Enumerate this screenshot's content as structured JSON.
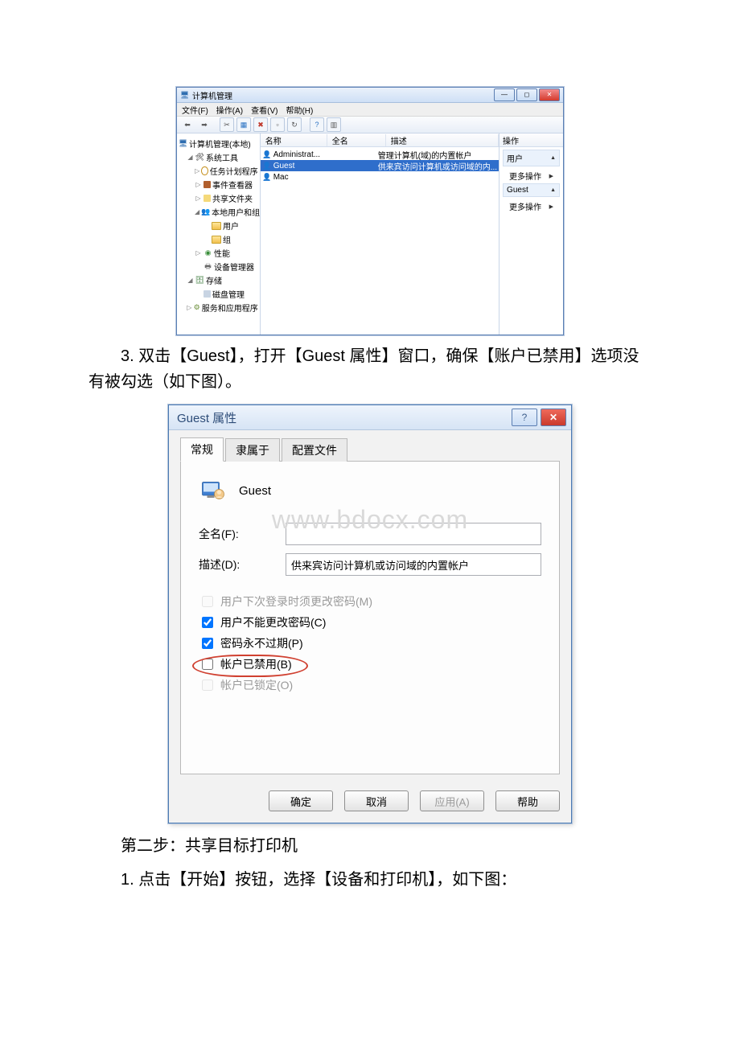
{
  "mmc": {
    "title": "计算机管理",
    "menus": [
      "文件(F)",
      "操作(A)",
      "查看(V)",
      "帮助(H)"
    ],
    "tree": {
      "root": "计算机管理(本地)",
      "systools": "系统工具",
      "task": "任务计划程序",
      "event": "事件查看器",
      "shared": "共享文件夹",
      "localusers": "本地用户和组",
      "users": "用户",
      "groups": "组",
      "perf": "性能",
      "devmgr": "设备管理器",
      "storage": "存储",
      "diskmgmt": "磁盘管理",
      "svcapps": "服务和应用程序"
    },
    "list": {
      "headers": {
        "name": "名称",
        "fullname": "全名",
        "desc": "描述"
      },
      "rows": [
        {
          "name": "Administrat...",
          "full": "",
          "desc": "管理计算机(域)的内置帐户"
        },
        {
          "name": "Guest",
          "full": "",
          "desc": "供来宾访问计算机或访问域的内..."
        },
        {
          "name": "Mac",
          "full": "",
          "desc": ""
        }
      ]
    },
    "actions": {
      "header": "操作",
      "sections": [
        {
          "title": "用户",
          "item": "更多操作"
        },
        {
          "title": "Guest",
          "item": "更多操作"
        }
      ]
    }
  },
  "para1": "3. 双击【Guest】，打开【Guest 属性】窗口，确保【账户已禁用】选项没有被勾选（如下图）。",
  "dlg": {
    "title": "Guest 属性",
    "tabs": [
      "常规",
      "隶属于",
      "配置文件"
    ],
    "username": "Guest",
    "watermark": "www.bdocx.com",
    "fullname_label": "全名(F):",
    "fullname_value": "",
    "desc_label": "描述(D):",
    "desc_value": "供来宾访问计算机或访问域的内置帐户",
    "checks": {
      "mustchange": "用户下次登录时须更改密码(M)",
      "cannotchange": "用户不能更改密码(C)",
      "neverexpire": "密码永不过期(P)",
      "disabled": "帐户已禁用(B)",
      "locked": "帐户已锁定(O)"
    },
    "buttons": {
      "ok": "确定",
      "cancel": "取消",
      "apply": "应用(A)",
      "help": "帮助"
    }
  },
  "para2": "第二步：共享目标打印机",
  "para3": "1. 点击【开始】按钮，选择【设备和打印机】，如下图："
}
